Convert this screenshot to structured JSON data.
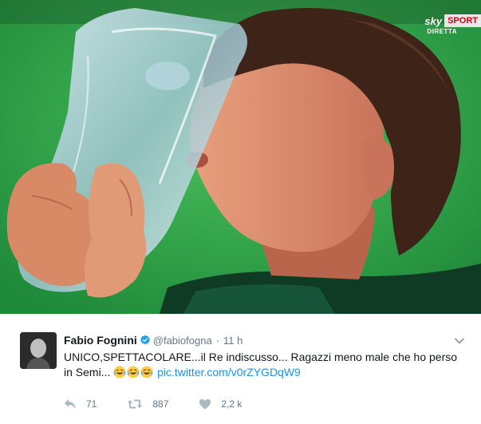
{
  "photo": {
    "broadcaster": "sky",
    "broadcaster_tag": "SPORT",
    "live_label": "DIRETTA"
  },
  "tweet": {
    "author_name": "Fabio Fognini",
    "handle": "@fabiofogna",
    "separator": "·",
    "time": "11 h",
    "text_main": "UNICO,SPETTACOLARE...il Re indiscusso... Ragazzi meno male che ho perso in Semi...",
    "emojis": [
      "face-with-tears-of-joy",
      "face-with-tears-of-joy",
      "face-with-tears-of-joy"
    ],
    "link": "pic.twitter.com/v0rZYGDqW9",
    "reply_count": "71",
    "retweet_count": "887",
    "like_count": "2,2 k"
  },
  "colors": {
    "link": "#1b95e0",
    "verified": "#1da1f2",
    "muted": "#657786",
    "text": "#14171a",
    "court_green": "#31a34e"
  },
  "icons": {
    "verified": "verified-badge-icon",
    "caret": "chevron-down-icon",
    "reply": "reply-icon",
    "retweet": "retweet-icon",
    "like": "heart-icon"
  }
}
